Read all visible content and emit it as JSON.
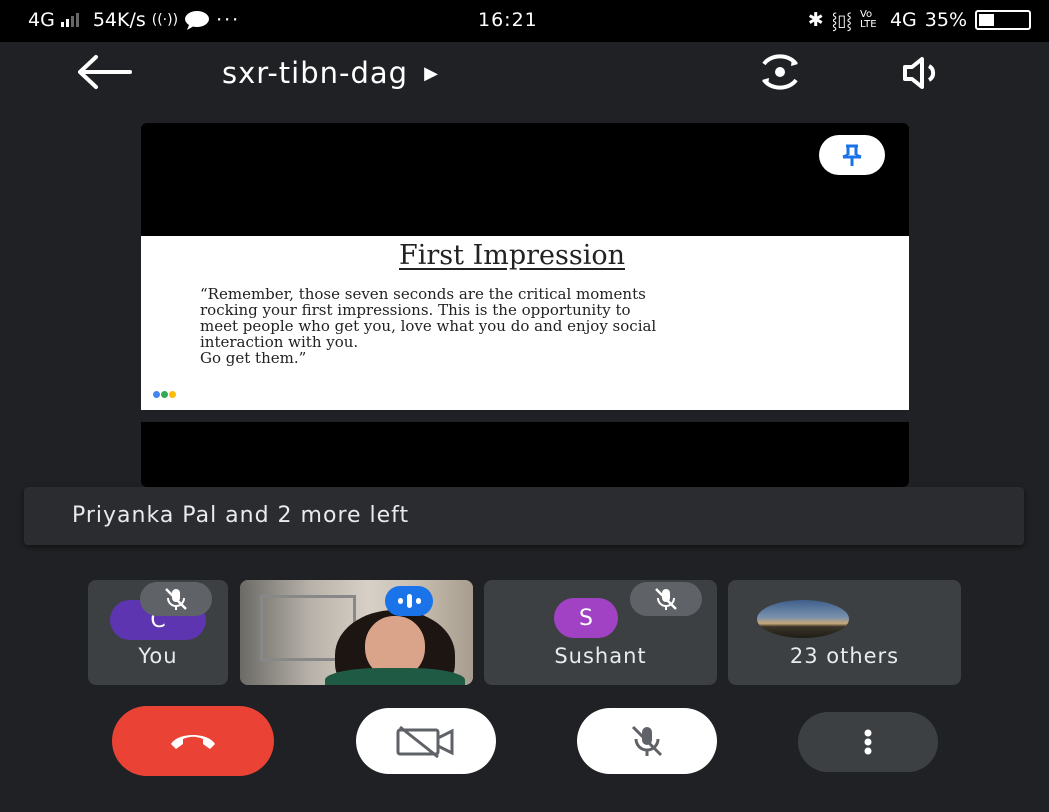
{
  "status_bar": {
    "network": "4G",
    "speed": "54K/s",
    "time": "16:21",
    "right_indicators": "Vo LTE",
    "network_right": "4G",
    "battery": "35%"
  },
  "meeting": {
    "code": "sxr-tibn-dag"
  },
  "slide": {
    "title": "First Impression",
    "quote": "“Remember, those seven seconds are the critical moments\nrocking your first impressions. This is the opportunity to\nmeet people who get you, love what you do and enjoy social\ninteraction with you.\nGo get them.”"
  },
  "toast": {
    "message": "Priyanka Pal and 2 more left"
  },
  "participants": [
    {
      "name": "You",
      "initial": "C",
      "avatar_color": "#5e35b1",
      "muted": true
    },
    {
      "name": "",
      "type": "video",
      "speaking": true
    },
    {
      "name": "Sushant",
      "initial": "S",
      "avatar_color": "#a142c4",
      "muted": true
    },
    {
      "name": "23 others"
    }
  ],
  "controls": {
    "end_call_color": "#ea4335",
    "icons": [
      "phone-hangup-icon",
      "video-off-icon",
      "mic-off-icon",
      "more-vert-icon"
    ]
  },
  "colors": {
    "background": "#202124",
    "tile": "#3c4043",
    "accent": "#1a73e8"
  }
}
